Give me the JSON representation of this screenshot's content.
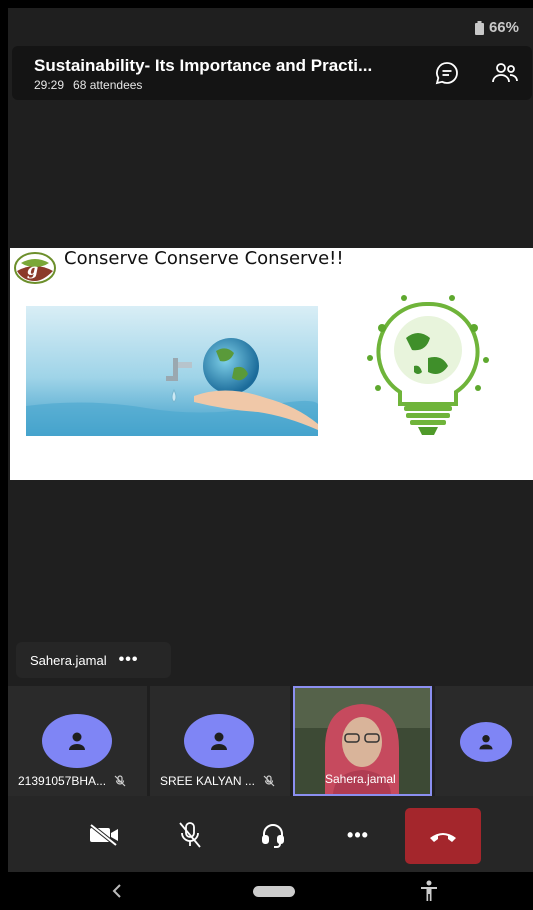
{
  "status": {
    "battery": "66%"
  },
  "meeting": {
    "title": "Sustainability- Its Importance and Practi...",
    "duration": "29:29",
    "attendees": "68 attendees"
  },
  "slide": {
    "title": "Conserve Conserve Conserve!!"
  },
  "presenter": {
    "name": "Sahera.jamal",
    "more": "•••"
  },
  "participants": [
    {
      "name": "21391057BHA..."
    },
    {
      "name": "SREE KALYAN ..."
    },
    {
      "name": "Sahera.jamal"
    }
  ],
  "controls": {
    "more": "•••"
  },
  "colors": {
    "accent": "#7f85f5",
    "hangup": "#a4262c",
    "background": "#1f1f1f"
  },
  "icons": [
    "battery-icon",
    "chat-icon",
    "people-icon",
    "video-off-icon",
    "mic-off-icon",
    "headset-icon",
    "more-icon",
    "hang-up-icon",
    "back-icon",
    "home-icon",
    "accessibility-icon"
  ]
}
